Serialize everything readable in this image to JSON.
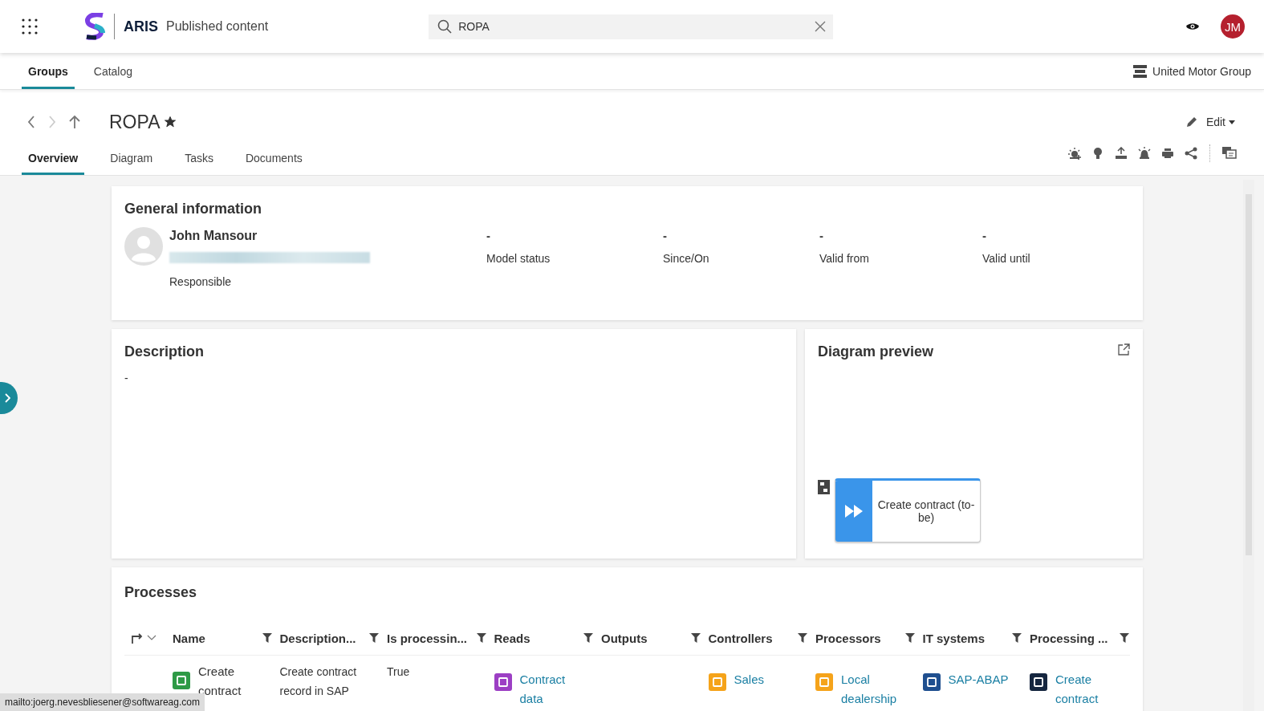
{
  "header": {
    "app_name": "ARIS",
    "section": "Published content",
    "search": {
      "value": "ROPA"
    },
    "avatar": {
      "initials": "JM",
      "color": "#b5202e"
    }
  },
  "nav_tabs": [
    {
      "label": "Groups",
      "selected": true
    },
    {
      "label": "Catalog",
      "selected": false
    }
  ],
  "database": "United Motor Group",
  "page": {
    "title": "ROPA",
    "favorite": true,
    "forward_disabled": true,
    "edit_label": "Edit"
  },
  "sub_tabs": [
    {
      "label": "Overview",
      "selected": true
    },
    {
      "label": "Diagram",
      "selected": false
    },
    {
      "label": "Tasks",
      "selected": false
    },
    {
      "label": "Documents",
      "selected": false
    }
  ],
  "general_information": {
    "title": "General information",
    "person": {
      "name": "John Mansour",
      "role": "Responsible"
    },
    "fields": [
      {
        "value": "-",
        "label": "Model status"
      },
      {
        "value": "-",
        "label": "Since/On"
      },
      {
        "value": "-",
        "label": "Valid from"
      },
      {
        "value": "-",
        "label": "Valid until"
      }
    ]
  },
  "description": {
    "title": "Description",
    "text": "-"
  },
  "diagram_preview": {
    "title": "Diagram preview",
    "node": "Create contract (to-be)"
  },
  "processes": {
    "title": "Processes",
    "columns": [
      "Name",
      "Description...",
      "Is processin...",
      "Reads",
      "Outputs",
      "Controllers",
      "Processors",
      "IT systems",
      "Processing ..."
    ],
    "rows": [
      {
        "cells": [
          {
            "kind": "object",
            "text": "Create contract",
            "link": false,
            "color": "#2e9a46"
          },
          {
            "kind": "text",
            "text": "Create contract record in SAP"
          },
          {
            "kind": "text",
            "text": "True"
          },
          {
            "kind": "object",
            "text": "Contract data",
            "link": true,
            "color": "#9c3fc4"
          },
          {
            "kind": "empty"
          },
          {
            "kind": "object",
            "text": "Sales",
            "link": true,
            "color": "#f5a31a"
          },
          {
            "kind": "object",
            "text": "Local dealership",
            "link": true,
            "color": "#f5a31a"
          },
          {
            "kind": "object",
            "text": "SAP-ABAP",
            "link": true,
            "color": "#1f4f8f"
          },
          {
            "kind": "object",
            "text": "Create contract",
            "link": true,
            "color": "#15263f"
          }
        ]
      }
    ]
  },
  "status_bar": {
    "text": "mailto:joerg.nevesbliesener@softwareag.com"
  }
}
